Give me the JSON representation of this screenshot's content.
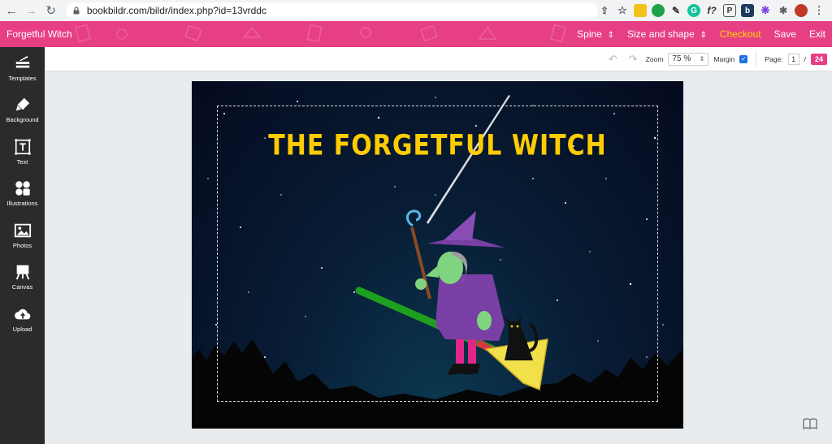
{
  "browser": {
    "url": "bookbildr.com/bildr/index.php?id=13vrddc"
  },
  "app": {
    "title": "Forgetful Witch",
    "menu": {
      "spine": "Spine",
      "size_shape": "Size and shape",
      "checkout": "Checkout",
      "save": "Save",
      "exit": "Exit"
    }
  },
  "sidebar": {
    "items": [
      {
        "label": "Templates",
        "icon": "templates-icon"
      },
      {
        "label": "Background",
        "icon": "paint-brush-icon"
      },
      {
        "label": "Text",
        "icon": "text-icon"
      },
      {
        "label": "Illustrations",
        "icon": "illustrations-icon"
      },
      {
        "label": "Photos",
        "icon": "photo-icon"
      },
      {
        "label": "Canvas",
        "icon": "easel-icon"
      },
      {
        "label": "Upload",
        "icon": "cloud-upload-icon"
      }
    ]
  },
  "toolbar": {
    "zoom_label": "Zoom",
    "zoom_value": "75 %",
    "margin_label": "Margin",
    "margin_checked": true,
    "page_label": "Page:",
    "page_current": "1",
    "page_sep": "/",
    "page_total": "24"
  },
  "canvas": {
    "title": "THE FORGETFUL WITCH"
  },
  "colors": {
    "brand": "#e73f84",
    "checkout": "#ffd700",
    "sidebar": "#2b2b2b",
    "title": "#ffcc00"
  }
}
